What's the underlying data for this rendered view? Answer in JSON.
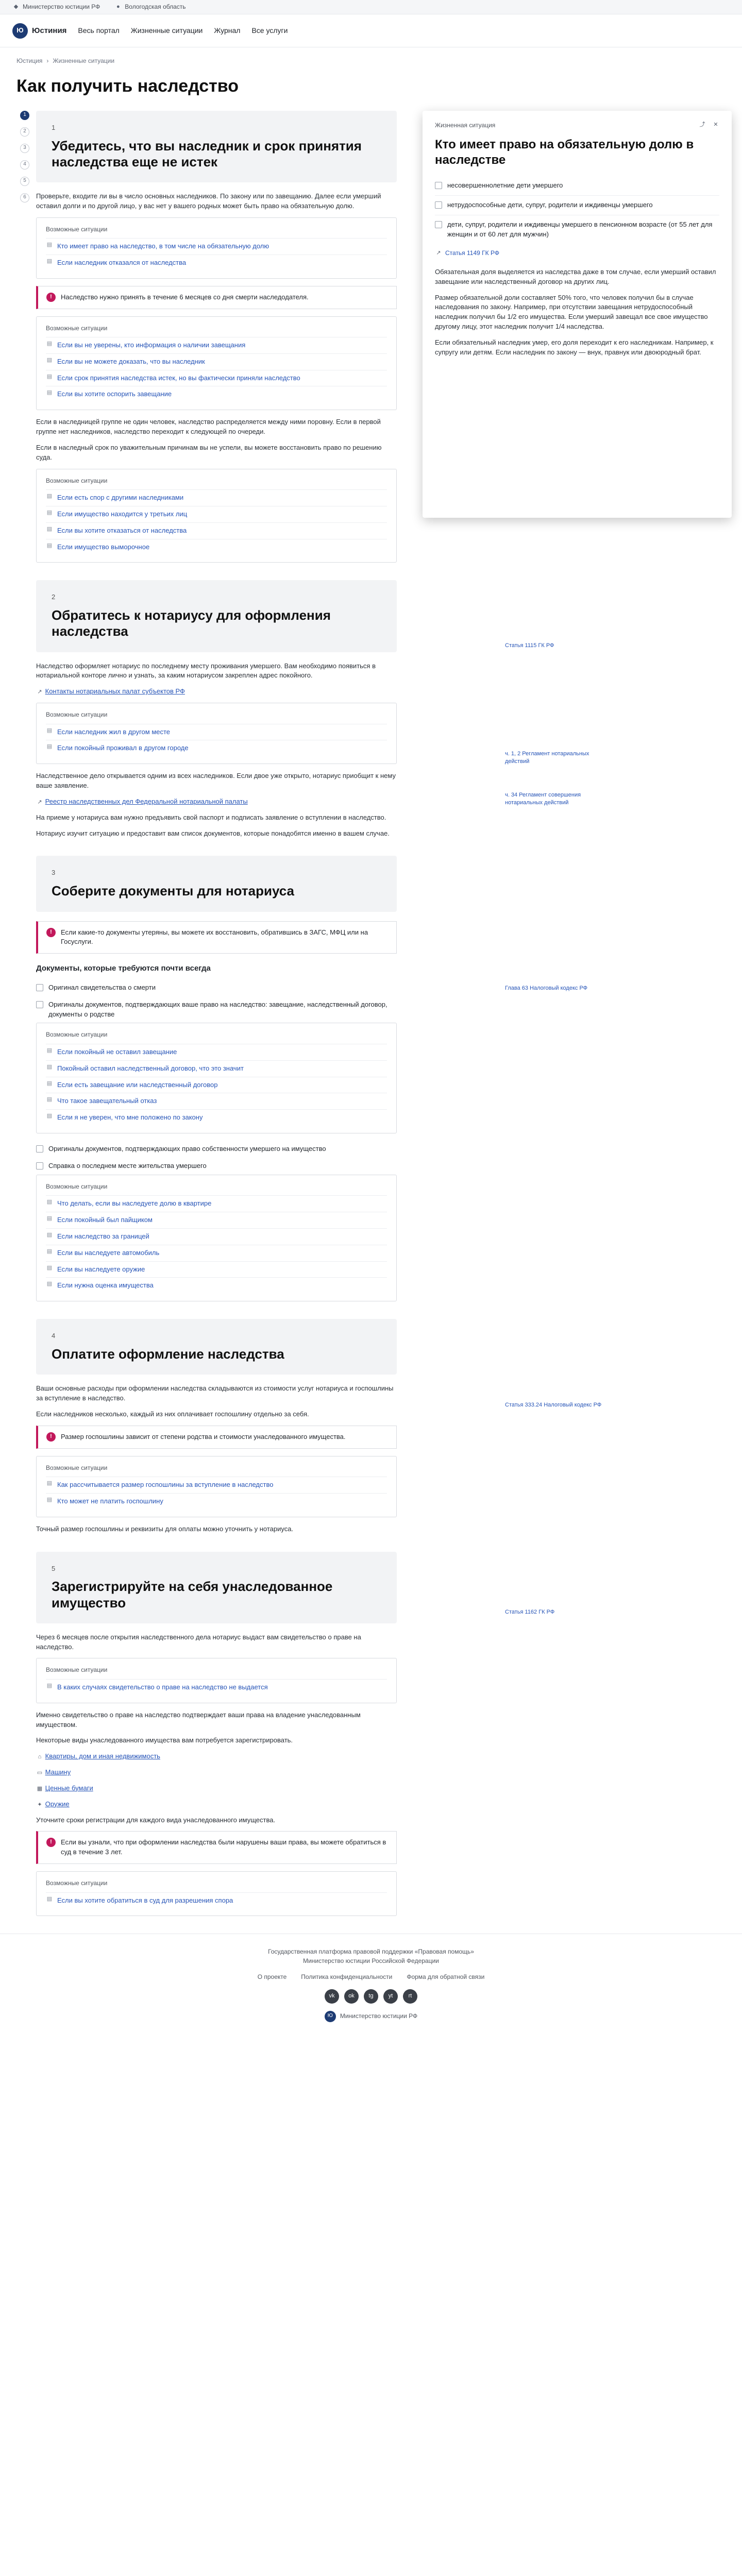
{
  "topstrip": {
    "ministry": "Министерство юстиции РФ",
    "region": "Вологодская область"
  },
  "header": {
    "logo": "Юстиния",
    "logo_mark": "Ю",
    "nav": [
      "Весь портал",
      "Жизненные ситуации",
      "Журнал",
      "Все услуги"
    ]
  },
  "breadcrumbs": [
    "Юстиция",
    "Жизненные ситуации"
  ],
  "page_title": "Как получить наследство",
  "rail": [
    "1",
    "2",
    "3",
    "4",
    "5",
    "6"
  ],
  "popup": {
    "label": "Жизненная ситуация",
    "title": "Кто имеет право на обязательную долю в наследстве",
    "items": [
      "несовершеннолетние дети умершего",
      "нетрудоспособные дети, супруг, родители и иждивенцы умершего",
      "дети, супруг, родители и иждивенцы умершего в пенсионном возрасте (от 55 лет для женщин и от 60 лет для мужчин)"
    ],
    "source": "Статья 1149 ГК РФ",
    "paragraphs": [
      "Обязательная доля выделяется из наследства даже в том случае, если умерший оставил завещание или наследственный договор на других лиц.",
      "Размер обязательной доли составляет 50% того, что человек получил бы в случае наследования по закону. Например, при отсутствии завещания нетрудоспособный наследник получил бы 1/2 его имущества. Если умерший завещал все свое имущество другому лицу, этот наследник получит 1/4 наследства.",
      "Если обязательный наследник умер, его доля переходит к его наследникам. Например, к супругу или детям. Если наследник по закону — внук, правнук или двоюродный брат."
    ]
  },
  "steps": [
    {
      "num": "1",
      "title": "Убедитесь, что вы наследник и срок принятия наследства еще не истек",
      "paragraphs": [
        "Проверьте, входите ли вы в число основных наследников. По закону или по завещанию. Далее если умерший оставил долги и по другой лицо, у вас нет у вашего родных может быть право на обязательную долю.",
        "Если в наследницей группе не один человек, наследство распределяется между ними поровну. Если в первой группе нет наследников, наследство переходит к следующей по очереди.",
        "Если в наследный срок по уважительным причинам вы не успели, вы можете восстановить право по решению суда."
      ],
      "boxes": [
        {
          "head": "Возможные ситуации",
          "items": [
            "Кто имеет право на наследство, в том числе на обязательную долю",
            "Если наследник отказался от наследства"
          ]
        },
        {
          "head": "Возможные ситуации",
          "items": [
            "Если вы не уверены, кто информация о наличии завещания",
            "Если вы не можете доказать, что вы наследник",
            "Если срок принятия наследства истек, но вы фактически приняли наследство",
            "Если вы хотите оспорить завещание"
          ]
        },
        {
          "head": "Возможные ситуации",
          "items": [
            "Если есть спор с другими наследниками",
            "Если имущество находится у третьих лиц",
            "Если вы хотите отказаться от наследства",
            "Если имущество выморочное"
          ]
        }
      ],
      "notice": "Наследство нужно принять в течение 6 месяцев со дня смерти наследодателя."
    },
    {
      "num": "2",
      "title": "Обратитесь к нотариусу для оформления наследства",
      "paragraphs": [
        "Наследство оформляет нотариус по последнему месту проживания умершего. Вам необходимо появиться в нотариальной конторе лично и узнать, за каким нотариусом закреплен адрес покойного.",
        "Наследственное дело открывается одним из всех наследников. Если двое уже открыто, нотариус приобщит к нему ваше заявление.",
        "На приеме у нотариуса вам нужно предъявить свой паспорт и подписать заявление о вступлении в наследство.",
        "Нотариус изучит ситуацию и предоставит вам список документов, которые понадобятся именно в вашем случае."
      ],
      "links": [
        "Контакты нотариальных палат субъектов РФ",
        "Реестр наследственных дел Федеральной нотариальной палаты"
      ],
      "boxes": [
        {
          "head": "Возможные ситуации",
          "items": [
            "Если наследник жил в другом месте",
            "Если покойный проживал в другом городе"
          ]
        }
      ],
      "side": [
        "Статья 1115 ГК РФ",
        "ч. 1, 2 Регламент нотариальных действий",
        "ч. 34 Регламент совершения нотариальных действий"
      ]
    },
    {
      "num": "3",
      "title": "Соберите документы для нотариуса",
      "notice": "Если какие-то документы утеряны, вы можете их восстановить, обратившись в ЗАГС, МФЦ или на Госуслуги.",
      "subhead": "Документы, которые требуются почти всегда",
      "docs": [
        "Оригинал свидетельства о смерти",
        "Оригиналы документов, подтверждающих ваше право на наследство: завещание, наследственный договор, документы о родстве",
        "Оригиналы документов, подтверждающих право собственности умершего на имущество",
        "Справка о последнем месте жительства умершего"
      ],
      "boxes": [
        {
          "head": "Возможные ситуации",
          "items": [
            "Если покойный не оставил завещание",
            "Покойный оставил наследственный договор, что это значит",
            "Если есть завещание или наследственный договор",
            "Что такое завещательный отказ",
            "Если я не уверен, что мне положено по закону"
          ]
        },
        {
          "head": "Возможные ситуации",
          "items": [
            "Что делать, если вы наследуете долю в квартире",
            "Если покойный был пайщиком",
            "Если наследство за границей",
            "Если вы наследуете автомобиль",
            "Если вы наследуете оружие",
            "Если нужна оценка имущества"
          ]
        }
      ],
      "side": [
        "Глава 63 Налоговый кодекс РФ"
      ]
    },
    {
      "num": "4",
      "title": "Оплатите оформление наследства",
      "paragraphs": [
        "Ваши основные расходы при оформлении наследства складываются из стоимости услуг нотариуса и госпошлины за вступление в наследство.",
        "Если наследников несколько, каждый из них оплачивает госпошлину отдельно за себя.",
        "Точный размер госпошлины и реквизиты для оплаты можно уточнить у нотариуса."
      ],
      "notice": "Размер госпошлины зависит от степени родства и стоимости унаследованного имущества.",
      "boxes": [
        {
          "head": "Возможные ситуации",
          "items": [
            "Как рассчитывается размер госпошлины за вступление в наследство",
            "Кто может не платить госпошлину"
          ]
        }
      ],
      "side": [
        "Статья 333.24 Налоговый кодекс РФ"
      ]
    },
    {
      "num": "5",
      "title": "Зарегистрируйте на себя унаследованное имущество",
      "paragraphs": [
        "Через 6 месяцев после открытия наследственного дела нотариус выдаст вам свидетельство о праве на наследство.",
        "Именно свидетельство о праве на наследство подтверждает ваши права на владение унаследованным имуществом.",
        "Некоторые виды унаследованного имущества вам потребуется зарегистрировать.",
        "Уточните сроки регистрации для каждого вида унаследованного имущества."
      ],
      "links": [
        "Квартиры, дом и иная недвижимость",
        "Машину",
        "Ценные бумаги",
        "Оружие"
      ],
      "notice": "Если вы узнали, что при оформлении наследства были нарушены ваши права, вы можете обратиться в суд в течение 3 лет.",
      "boxes": [
        {
          "head": "Возможные ситуации",
          "items": [
            "В каких случаях свидетельство о праве на наследство не выдается"
          ]
        },
        {
          "head": "Возможные ситуации",
          "items": [
            "Если вы хотите обратиться в суд для разрешения спора"
          ]
        }
      ],
      "side": [
        "Статья 1162 ГК РФ"
      ]
    }
  ],
  "footer": {
    "line": "Государственная платформа правовой поддержки «Правовая помощь»",
    "sub": "Министерство юстиции Российской Федерации",
    "links": [
      "О проекте",
      "Политика конфиденциальности",
      "Форма для обратной связи"
    ],
    "social": [
      "vk",
      "ok",
      "tg",
      "yt",
      "rt"
    ],
    "logo": "Министерство юстиции РФ"
  }
}
